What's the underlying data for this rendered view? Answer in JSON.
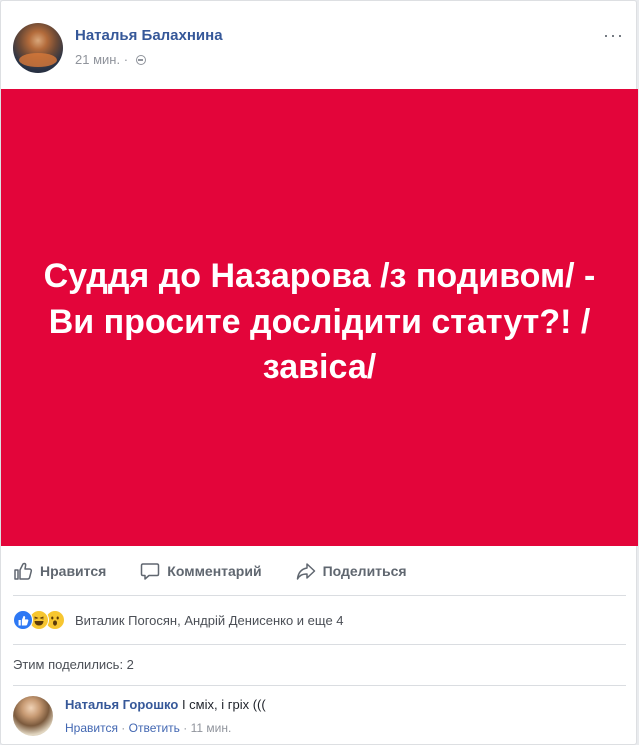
{
  "post": {
    "author": "Наталья Балахнина",
    "time": "21 мин.",
    "separator": "·",
    "privacy_icon": "globe-icon",
    "more_glyph": "···",
    "image_text": "Суддя до Назарова /з подивом/ - Ви просите дослідити статут?! /завіса/",
    "image_bg": "#e3053a"
  },
  "actions": {
    "like": "Нравится",
    "comment": "Комментарий",
    "share": "Поделиться"
  },
  "reactions": {
    "icons": [
      "like-icon",
      "haha-icon",
      "wow-icon"
    ],
    "summary": "Виталик Погосян, Андрій Денисенко и еще 4"
  },
  "shares": "Этим поделились: 2",
  "comment": {
    "author": "Наталья Горошко",
    "text": "І сміх, і гріх (((",
    "like": "Нравится",
    "reply": "Ответить",
    "time": "11 мин.",
    "sep": "·"
  }
}
